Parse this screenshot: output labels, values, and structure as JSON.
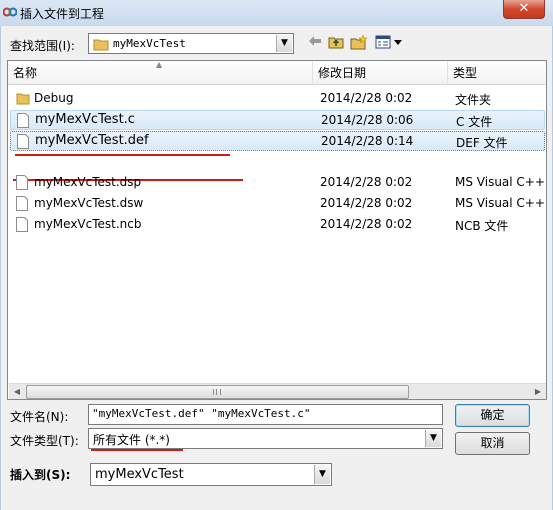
{
  "window": {
    "title": "插入文件到工程",
    "close_label": "✕"
  },
  "lookin": {
    "label": "查找范围(I):",
    "value": "myMexVcTest"
  },
  "toolbar": {
    "back_icon": "back-arrow-icon",
    "up_icon": "up-folder-icon",
    "newfolder_icon": "new-folder-icon",
    "view_icon": "view-menu-icon"
  },
  "filelist": {
    "columns": [
      "名称",
      "修改日期",
      "类型"
    ],
    "rows": [
      {
        "name": "Debug",
        "date": "2014/2/28 0:02",
        "type": "文件夹",
        "icon": "folder-icon"
      },
      {
        "name": "myMexVcTest.c",
        "date": "2014/2/28 0:06",
        "type": "C 文件",
        "icon": "file-icon"
      },
      {
        "name": "myMexVcTest.def",
        "date": "2014/2/28 0:14",
        "type": "DEF 文件",
        "icon": "file-icon"
      },
      {
        "name": "myMexVcTest.dsp",
        "date": "2014/2/28 0:02",
        "type": "MS Visual C++",
        "icon": "file-icon"
      },
      {
        "name": "myMexVcTest.dsw",
        "date": "2014/2/28 0:02",
        "type": "MS Visual C++",
        "icon": "file-icon"
      },
      {
        "name": "myMexVcTest.ncb",
        "date": "2014/2/28 0:02",
        "type": "NCB 文件",
        "icon": "file-icon"
      }
    ]
  },
  "filename": {
    "label": "文件名(N):",
    "value": "\"myMexVcTest.def\" \"myMexVcTest.c\""
  },
  "filetype": {
    "label": "文件类型(T):",
    "value": "所有文件 (*.*)"
  },
  "insertto": {
    "label": "插入到(S):",
    "value": "myMexVcTest"
  },
  "buttons": {
    "ok": "确定",
    "cancel": "取消"
  },
  "annotation_color": "#d11a1a"
}
